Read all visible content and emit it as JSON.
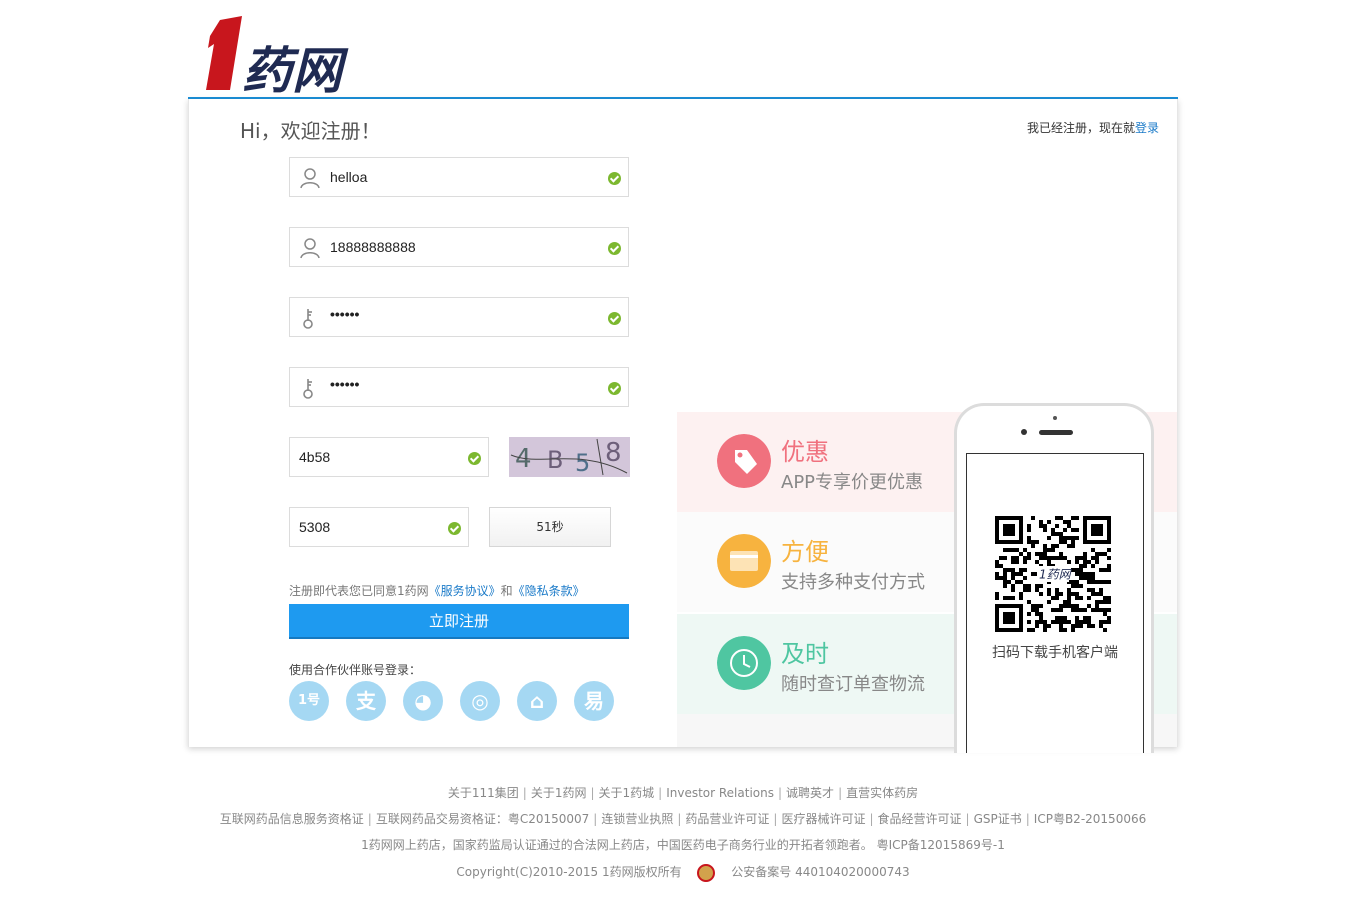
{
  "header": {
    "logo_text": "1药网",
    "brand_colors": {
      "one": "#c8161d",
      "text": "#1f2a52",
      "accent_line": "#1b8fd8"
    }
  },
  "register": {
    "welcome": "Hi，欢迎注册！",
    "login_hint_prefix": "我已经注册，现在就",
    "login_link": "登录",
    "username": "helloa",
    "phone": "18888888888",
    "password_mask": "••••••",
    "confirm_mask": "••••••",
    "captcha_value": "4b58",
    "captcha_image_text": [
      "4",
      "B",
      "5",
      "8"
    ],
    "sms_code": "5308",
    "sms_button": "51秒",
    "agree_prefix": "注册即代表您已同意1药网",
    "agree_service": "《服务协议》",
    "agree_and": "和",
    "agree_privacy": "《隐私条款》",
    "submit": "立即注册",
    "partner_label": "使用合作伙伴账号登录：",
    "partners": [
      {
        "name": "1号店",
        "glyph": "1号"
      },
      {
        "name": "支付宝",
        "glyph": "支"
      },
      {
        "name": "QQ",
        "glyph": "◕"
      },
      {
        "name": "微博",
        "glyph": "◎"
      },
      {
        "name": "联合登录",
        "glyph": "⌂"
      },
      {
        "name": "网易",
        "glyph": "易"
      }
    ]
  },
  "promo": [
    {
      "title": "优惠",
      "subtitle": "APP专享价更优惠",
      "color": "#f0717e",
      "icon": "tag-icon"
    },
    {
      "title": "方便",
      "subtitle": "支持多种支付方式",
      "color": "#f7b33f",
      "icon": "card-icon"
    },
    {
      "title": "及时",
      "subtitle": "随时查订单查物流",
      "color": "#4fc6a1",
      "icon": "clock-icon"
    }
  ],
  "phone": {
    "scan_text": "扫码下载手机客户端"
  },
  "footer": {
    "row1": [
      "关于111集团",
      "关于1药网",
      "关于1药城",
      "Investor Relations",
      "诚聘英才",
      "直营实体药房"
    ],
    "row2": [
      "互联网药品信息服务资格证",
      "互联网药品交易资格证：粤C20150007",
      "连锁营业执照",
      "药品营业许可证",
      "医疗器械许可证",
      "食品经营许可证",
      "GSP证书",
      "ICP粤B2-20150066"
    ],
    "row3": "1药网网上药店，国家药监局认证通过的合法网上药店，中国医药电子商务行业的开拓者领跑者。 粤ICP备12015869号-1",
    "copyright": "Copyright(C)2010-2015 1药网版权所有",
    "police": "公安备案号 440104020000743"
  }
}
